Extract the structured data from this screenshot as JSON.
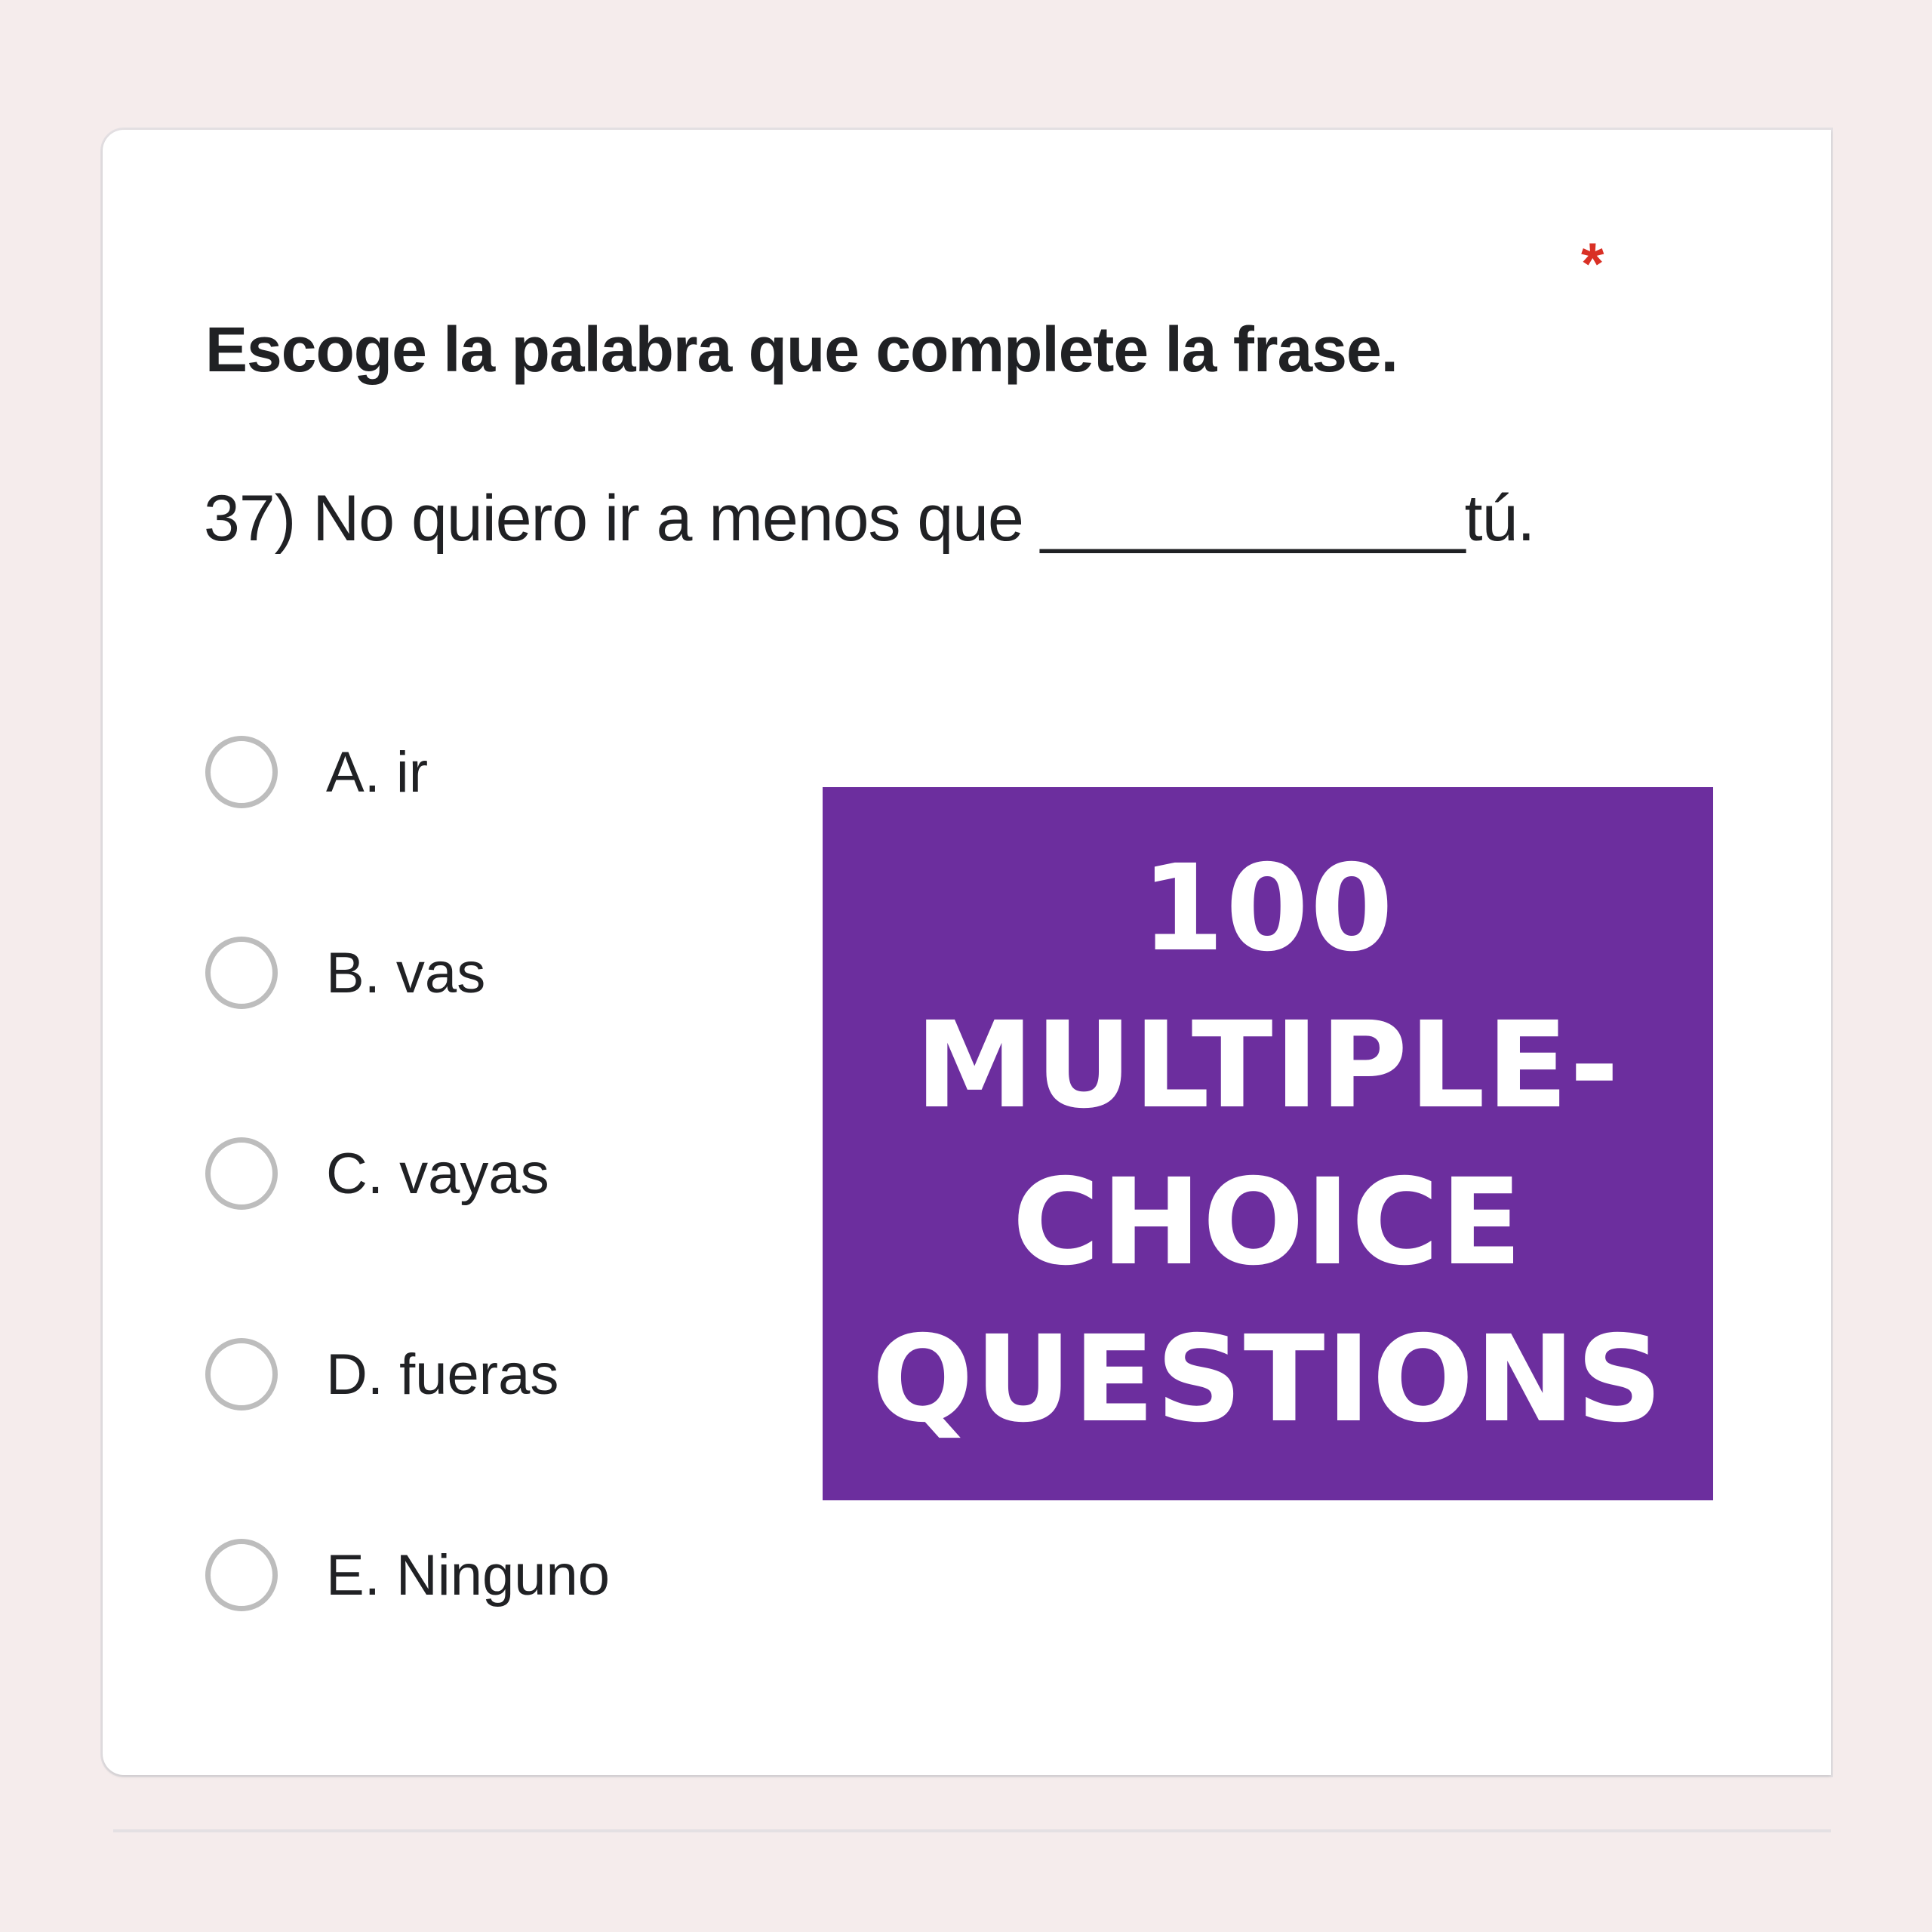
{
  "form": {
    "required_marker": "*",
    "instruction": "Escoge la palabra que complete la frase.",
    "question": "37)  No quiero ir a menos que ____________tú.",
    "options": [
      {
        "label": "A. ir"
      },
      {
        "label": "B. vas"
      },
      {
        "label": "C. vayas"
      },
      {
        "label": "D. fueras"
      },
      {
        "label": "E. Ninguno"
      }
    ]
  },
  "promo": {
    "lines": [
      "100",
      "MULTIPLE-",
      "CHOICE",
      "QUESTIONS"
    ]
  },
  "colors": {
    "background": "#f5ecec",
    "card": "#ffffff",
    "promo_accent": "#6c2e9e",
    "required": "#d93025"
  }
}
